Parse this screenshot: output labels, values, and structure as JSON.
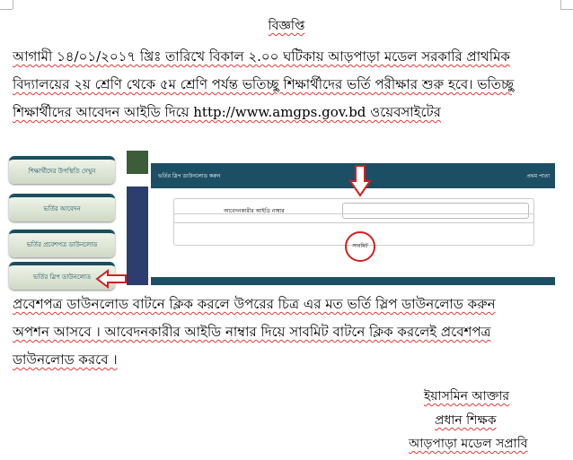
{
  "notice": {
    "title": "বিজ্ঞপ্তি",
    "para1": [
      "আগামী ১৪/০১/২০১৭ খ্রিঃ তারিখে বিকাল ২.০০ ঘটিকায় আড়পাড়া মডেল সরকারি প্রাথমিক",
      "বিদ্যালয়ের ২য় শ্রেণি থেকে ৫ম শ্রেণি পর্যন্ত ভতিচ্ছু শিক্ষার্থীদের ভর্তি পরীক্ষার শুরু হবে। ভতিচ্ছু",
      "শিক্ষার্থীদের আবেদন আইডি দিয়ে http://www.amgps.gov.bd ওয়েবসাইটের"
    ],
    "para2": [
      "প্রবেশপত্র ডাউনলোড বাটনে ক্লিক করলে উপরের চিত্র এর মত  ভর্তি স্লিপ ডাউনলোড করুন",
      "অপশন আসবে । আবেদনকারীর আইডি নাম্বার দিয়ে সাবমিট বাটনে ক্লিক করলেই প্রবেশপত্র",
      "ডাউনলোড করবে ।"
    ],
    "signature": {
      "name": "ইয়াসমিন আক্তার",
      "designation": "প্রধান শিক্ষক",
      "school": "আড়পাড়া মডেল সপ্রাবি"
    }
  },
  "screenshot": {
    "menu": [
      "শিক্ষার্থীদের উপস্থিতি দেখুন",
      "ভর্তির আবেদন",
      "ভর্তির প্রবেশপত্র ডাউনলোড",
      "ভর্তির স্লিপ ডাউনলোড"
    ],
    "panel_title": "ভর্তির স্লিপ ডাউনলোড করুন",
    "panel_link": "প্রথম পাতা",
    "field_label": "আবেদনকারীর আইডি নাম্বার",
    "submit_label": "সাবমিট",
    "accent": "#1d4f64",
    "highlight": "#d32020"
  }
}
